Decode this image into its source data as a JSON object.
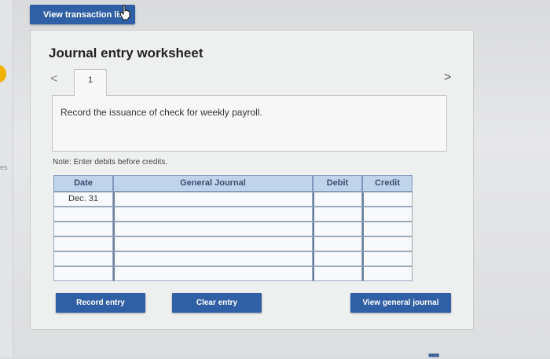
{
  "header": {
    "view_transaction_list": "View transaction list"
  },
  "worksheet": {
    "title": "Journal entry worksheet",
    "tab_number": "1",
    "prev_label": "<",
    "next_label": ">",
    "instruction": "Record the issuance of check for weekly payroll.",
    "note": "Note: Enter debits before credits."
  },
  "table": {
    "headers": [
      "Date",
      "General Journal",
      "Debit",
      "Credit"
    ],
    "rows": [
      {
        "date": "Dec. 31",
        "account": "",
        "debit": "",
        "credit": ""
      },
      {
        "date": "",
        "account": "",
        "debit": "",
        "credit": ""
      },
      {
        "date": "",
        "account": "",
        "debit": "",
        "credit": ""
      },
      {
        "date": "",
        "account": "",
        "debit": "",
        "credit": ""
      },
      {
        "date": "",
        "account": "",
        "debit": "",
        "credit": ""
      },
      {
        "date": "",
        "account": "",
        "debit": "",
        "credit": ""
      }
    ]
  },
  "actions": {
    "record_entry": "Record entry",
    "clear_entry": "Clear entry",
    "view_general_journal": "View general journal"
  },
  "side": {
    "mark": "es"
  },
  "colors": {
    "button_blue": "#2f5fa4",
    "header_blue": "#bfd3ea",
    "accent_yellow": "#f0b400"
  }
}
